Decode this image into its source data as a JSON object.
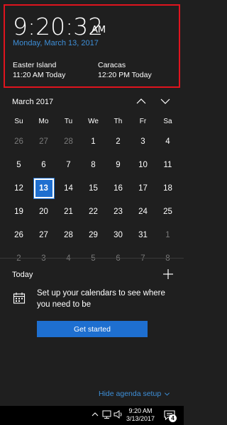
{
  "clock": {
    "time": "9:20:32",
    "ampm": "AM",
    "date": "Monday, March 13, 2017",
    "zones": [
      {
        "city": "Easter Island",
        "time": "11:20 AM Today"
      },
      {
        "city": "Caracas",
        "time": "12:20 PM Today"
      }
    ]
  },
  "calendar": {
    "month_label": "March 2017",
    "weekdays": [
      "Su",
      "Mo",
      "Tu",
      "We",
      "Th",
      "Fr",
      "Sa"
    ],
    "weeks": [
      [
        {
          "d": "26",
          "dim": true
        },
        {
          "d": "27",
          "dim": true
        },
        {
          "d": "28",
          "dim": true
        },
        {
          "d": "1"
        },
        {
          "d": "2"
        },
        {
          "d": "3"
        },
        {
          "d": "4"
        }
      ],
      [
        {
          "d": "5"
        },
        {
          "d": "6"
        },
        {
          "d": "7"
        },
        {
          "d": "8"
        },
        {
          "d": "9"
        },
        {
          "d": "10"
        },
        {
          "d": "11"
        }
      ],
      [
        {
          "d": "12"
        },
        {
          "d": "13",
          "today": true
        },
        {
          "d": "14"
        },
        {
          "d": "15"
        },
        {
          "d": "16"
        },
        {
          "d": "17"
        },
        {
          "d": "18"
        }
      ],
      [
        {
          "d": "19"
        },
        {
          "d": "20"
        },
        {
          "d": "21"
        },
        {
          "d": "22"
        },
        {
          "d": "23"
        },
        {
          "d": "24"
        },
        {
          "d": "25"
        }
      ],
      [
        {
          "d": "26"
        },
        {
          "d": "27"
        },
        {
          "d": "28"
        },
        {
          "d": "29"
        },
        {
          "d": "30"
        },
        {
          "d": "31"
        },
        {
          "d": "1",
          "dim": true
        }
      ],
      [
        {
          "d": "2",
          "dim": true
        },
        {
          "d": "3",
          "dim": true
        },
        {
          "d": "4",
          "dim": true
        },
        {
          "d": "5",
          "dim": true
        },
        {
          "d": "6",
          "dim": true
        },
        {
          "d": "7",
          "dim": true
        },
        {
          "d": "8",
          "dim": true
        }
      ]
    ]
  },
  "agenda": {
    "title": "Today",
    "setup_text": "Set up your calendars to see where you need to be",
    "get_started_label": "Get started",
    "hide_label": "Hide agenda setup"
  },
  "taskbar": {
    "time": "9:20 AM",
    "date": "3/13/2017",
    "notification_count": "4"
  },
  "icons": {
    "prev": "chevron-up-icon",
    "next": "chevron-down-icon",
    "add": "plus-icon",
    "calendar": "calendar-icon",
    "tray_up": "chevron-up-icon",
    "network": "network-icon",
    "volume": "volume-icon",
    "notification": "notification-icon"
  },
  "colors": {
    "background": "#1f1f1f",
    "accent": "#1e6fd0",
    "link": "#3e8fd8",
    "highlight_border": "#e0141e"
  }
}
